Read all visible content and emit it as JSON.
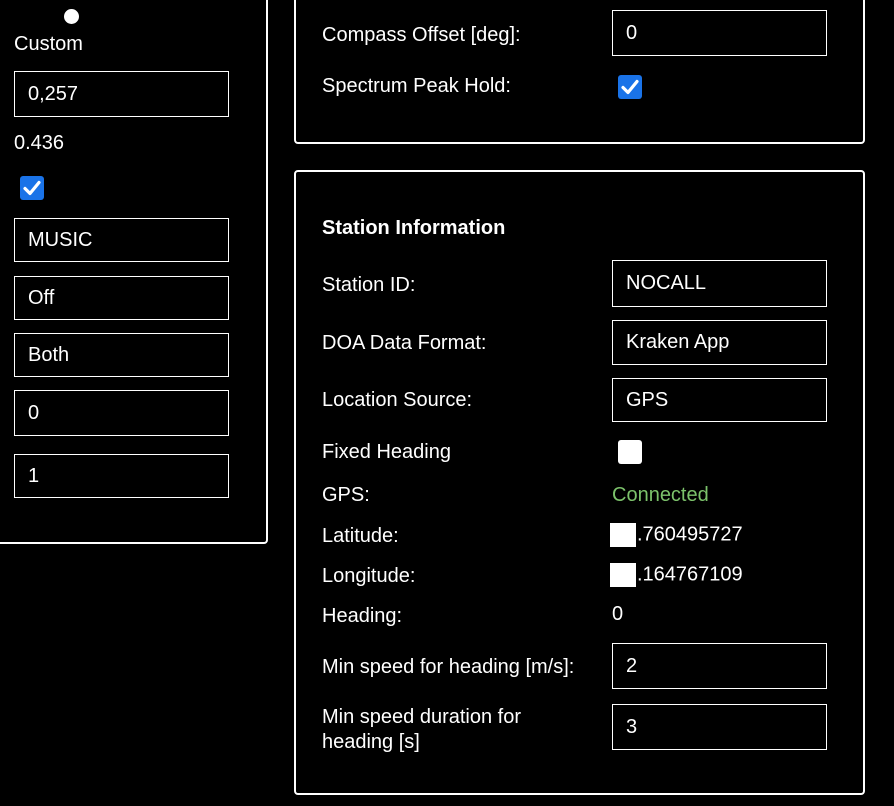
{
  "left": {
    "radio_label": "Custom",
    "custom_value": "0,257",
    "computed_value": "0.436",
    "checkbox_checked": true,
    "algorithm": "MUSIC",
    "mode": "Off",
    "sides": "Both",
    "field_a": "0",
    "field_b": "1"
  },
  "top": {
    "compass_offset_label": "Compass Offset [deg]:",
    "compass_offset_value": "0",
    "peak_hold_label": "Spectrum Peak Hold:",
    "peak_hold_checked": true
  },
  "station": {
    "title": "Station Information",
    "station_id_label": "Station ID:",
    "station_id_value": "NOCALL",
    "doa_format_label": "DOA Data Format:",
    "doa_format_value": "Kraken App",
    "location_source_label": "Location Source:",
    "location_source_value": "GPS",
    "fixed_heading_label": "Fixed Heading",
    "fixed_heading_checked": false,
    "gps_label": "GPS:",
    "gps_status": "Connected",
    "gps_status_color": "#7cc26b",
    "latitude_label": "Latitude:",
    "latitude_value": ".760495727",
    "longitude_label": "Longitude:",
    "longitude_value": ".164767109",
    "heading_label": "Heading:",
    "heading_value": "0",
    "min_speed_label": "Min speed for heading [m/s]:",
    "min_speed_value": "2",
    "min_duration_label_line1": "Min speed duration for",
    "min_duration_label_line2": "heading [s]",
    "min_duration_value": "3"
  },
  "colors": {
    "background": "#000000",
    "foreground": "#ffffff",
    "checkbox_accent": "#1a73e8"
  }
}
